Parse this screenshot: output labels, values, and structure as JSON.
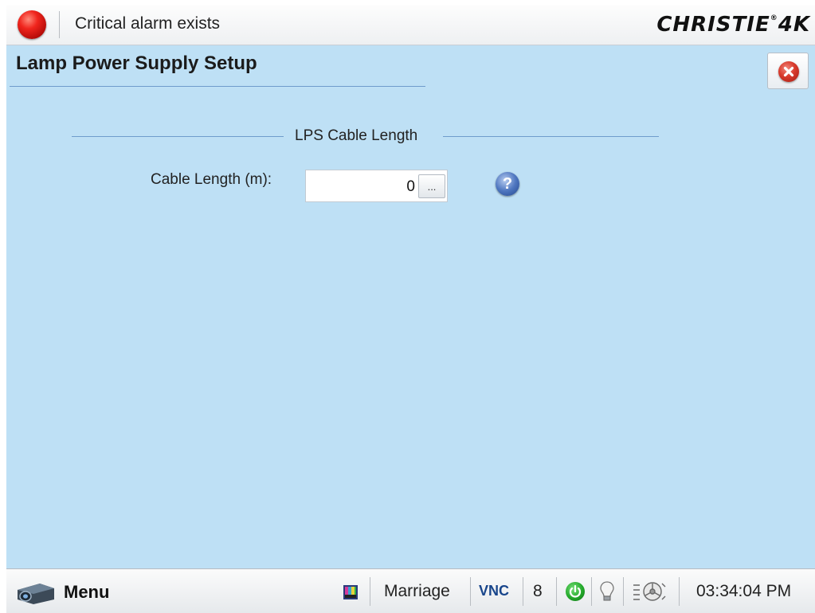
{
  "header": {
    "alarm_status": "Critical alarm exists",
    "alarm_icon": "red-alarm-indicator",
    "brand": "CHRISTIE",
    "brand_mark": "®",
    "brand_suffix": "4K"
  },
  "page": {
    "title": "Lamp Power Supply Setup",
    "close_icon": "close-x-icon"
  },
  "section": {
    "title": "LPS Cable Length",
    "field_label": "Cable Length (m):",
    "field_value": "0",
    "ellipsis_label": "...",
    "help_icon_glyph": "?"
  },
  "statusbar": {
    "menu_label": "Menu",
    "test_pattern_icon": "test-pattern-icon",
    "user": "Marriage",
    "vnc": "VNC",
    "connections": "8",
    "power_icon": "power-on-icon",
    "lamp_icon": "lamp-icon",
    "cooling_icon": "cooling-fan-icon",
    "time": "03:34:04 PM"
  },
  "colors": {
    "background": "#bee0f5",
    "divider_line": "#6f9ccc",
    "alarm": "#e0201a",
    "power": "#22a82a",
    "vnc_text": "#18458b"
  }
}
